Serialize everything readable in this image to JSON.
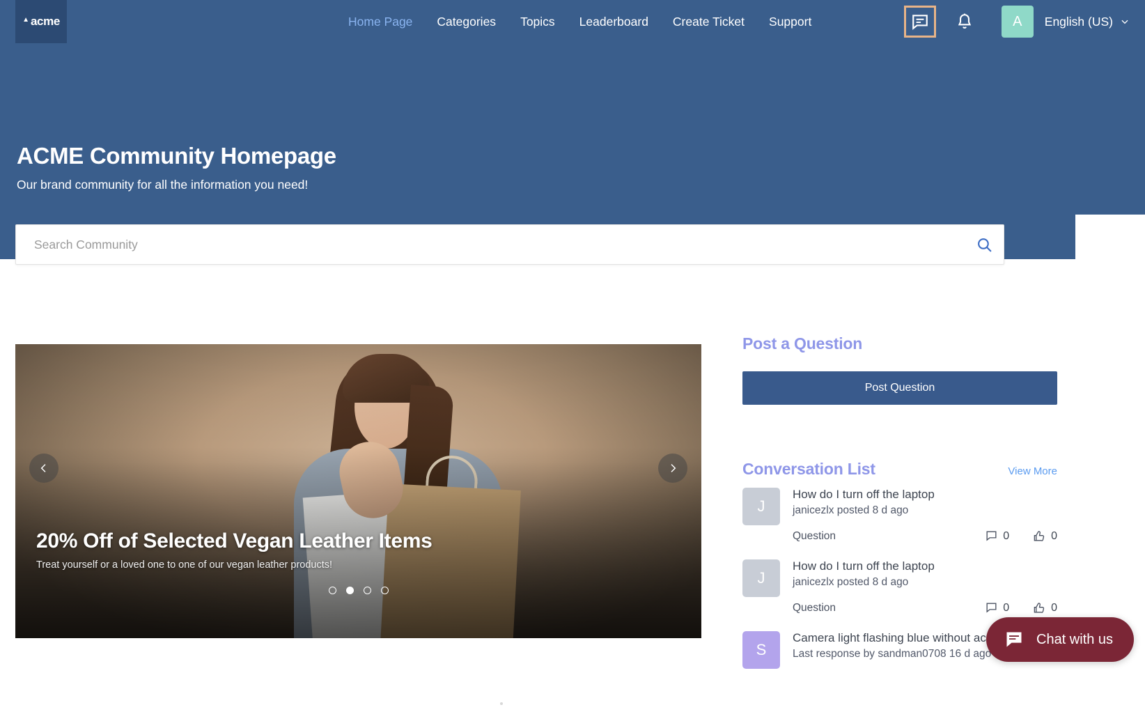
{
  "nav": {
    "logo_text": "acme",
    "links": [
      {
        "label": "Home Page",
        "active": true
      },
      {
        "label": "Categories",
        "active": false
      },
      {
        "label": "Topics",
        "active": false
      },
      {
        "label": "Leaderboard",
        "active": false
      },
      {
        "label": "Create Ticket",
        "active": false
      },
      {
        "label": "Support",
        "active": false
      }
    ],
    "messages_icon": "chat-bubble-icon",
    "notifications_icon": "bell-icon",
    "avatar_initial": "A",
    "avatar_color": "#8fd9c8",
    "language": "English (US)",
    "focus_ring_color": "#e8b488"
  },
  "hero": {
    "title": "ACME Community Homepage",
    "subtitle": "Our brand community for all the information you need!",
    "background_color": "#3a5e8c"
  },
  "search": {
    "placeholder": "Search Community",
    "value": "",
    "icon": "search-icon"
  },
  "carousel": {
    "title": "20% Off of Selected Vegan Leather Items",
    "subtitle": "Treat yourself or a loved one to one of our vegan leather products!",
    "prev_label": "‹",
    "next_label": "›",
    "slides": 4,
    "active_slide": 2
  },
  "post_question": {
    "heading": "Post a Question",
    "button_label": "Post Question",
    "heading_color": "#8e96e8",
    "button_color": "#395a8c"
  },
  "conversations": {
    "heading": "Conversation List",
    "view_more": "View More",
    "items": [
      {
        "avatar_initial": "J",
        "avatar_color": "#c8cdd6",
        "title": "How do I turn off the laptop",
        "meta": "janicezlx posted 8 d ago",
        "type": "Question",
        "comments": "0",
        "likes": "0"
      },
      {
        "avatar_initial": "J",
        "avatar_color": "#c8cdd6",
        "title": "How do I turn off the laptop",
        "meta": "janicezlx posted 8 d ago",
        "type": "Question",
        "comments": "0",
        "likes": "0"
      },
      {
        "avatar_initial": "S",
        "avatar_color": "#b3a4ec",
        "title": "Camera light flashing blue without ac",
        "meta": "Last response by sandman0708 16 d ago",
        "type": "",
        "comments": "",
        "likes": ""
      }
    ]
  },
  "chat_widget": {
    "label": "Chat with us",
    "icon": "chat-bubble-icon",
    "color": "#7b2636"
  }
}
